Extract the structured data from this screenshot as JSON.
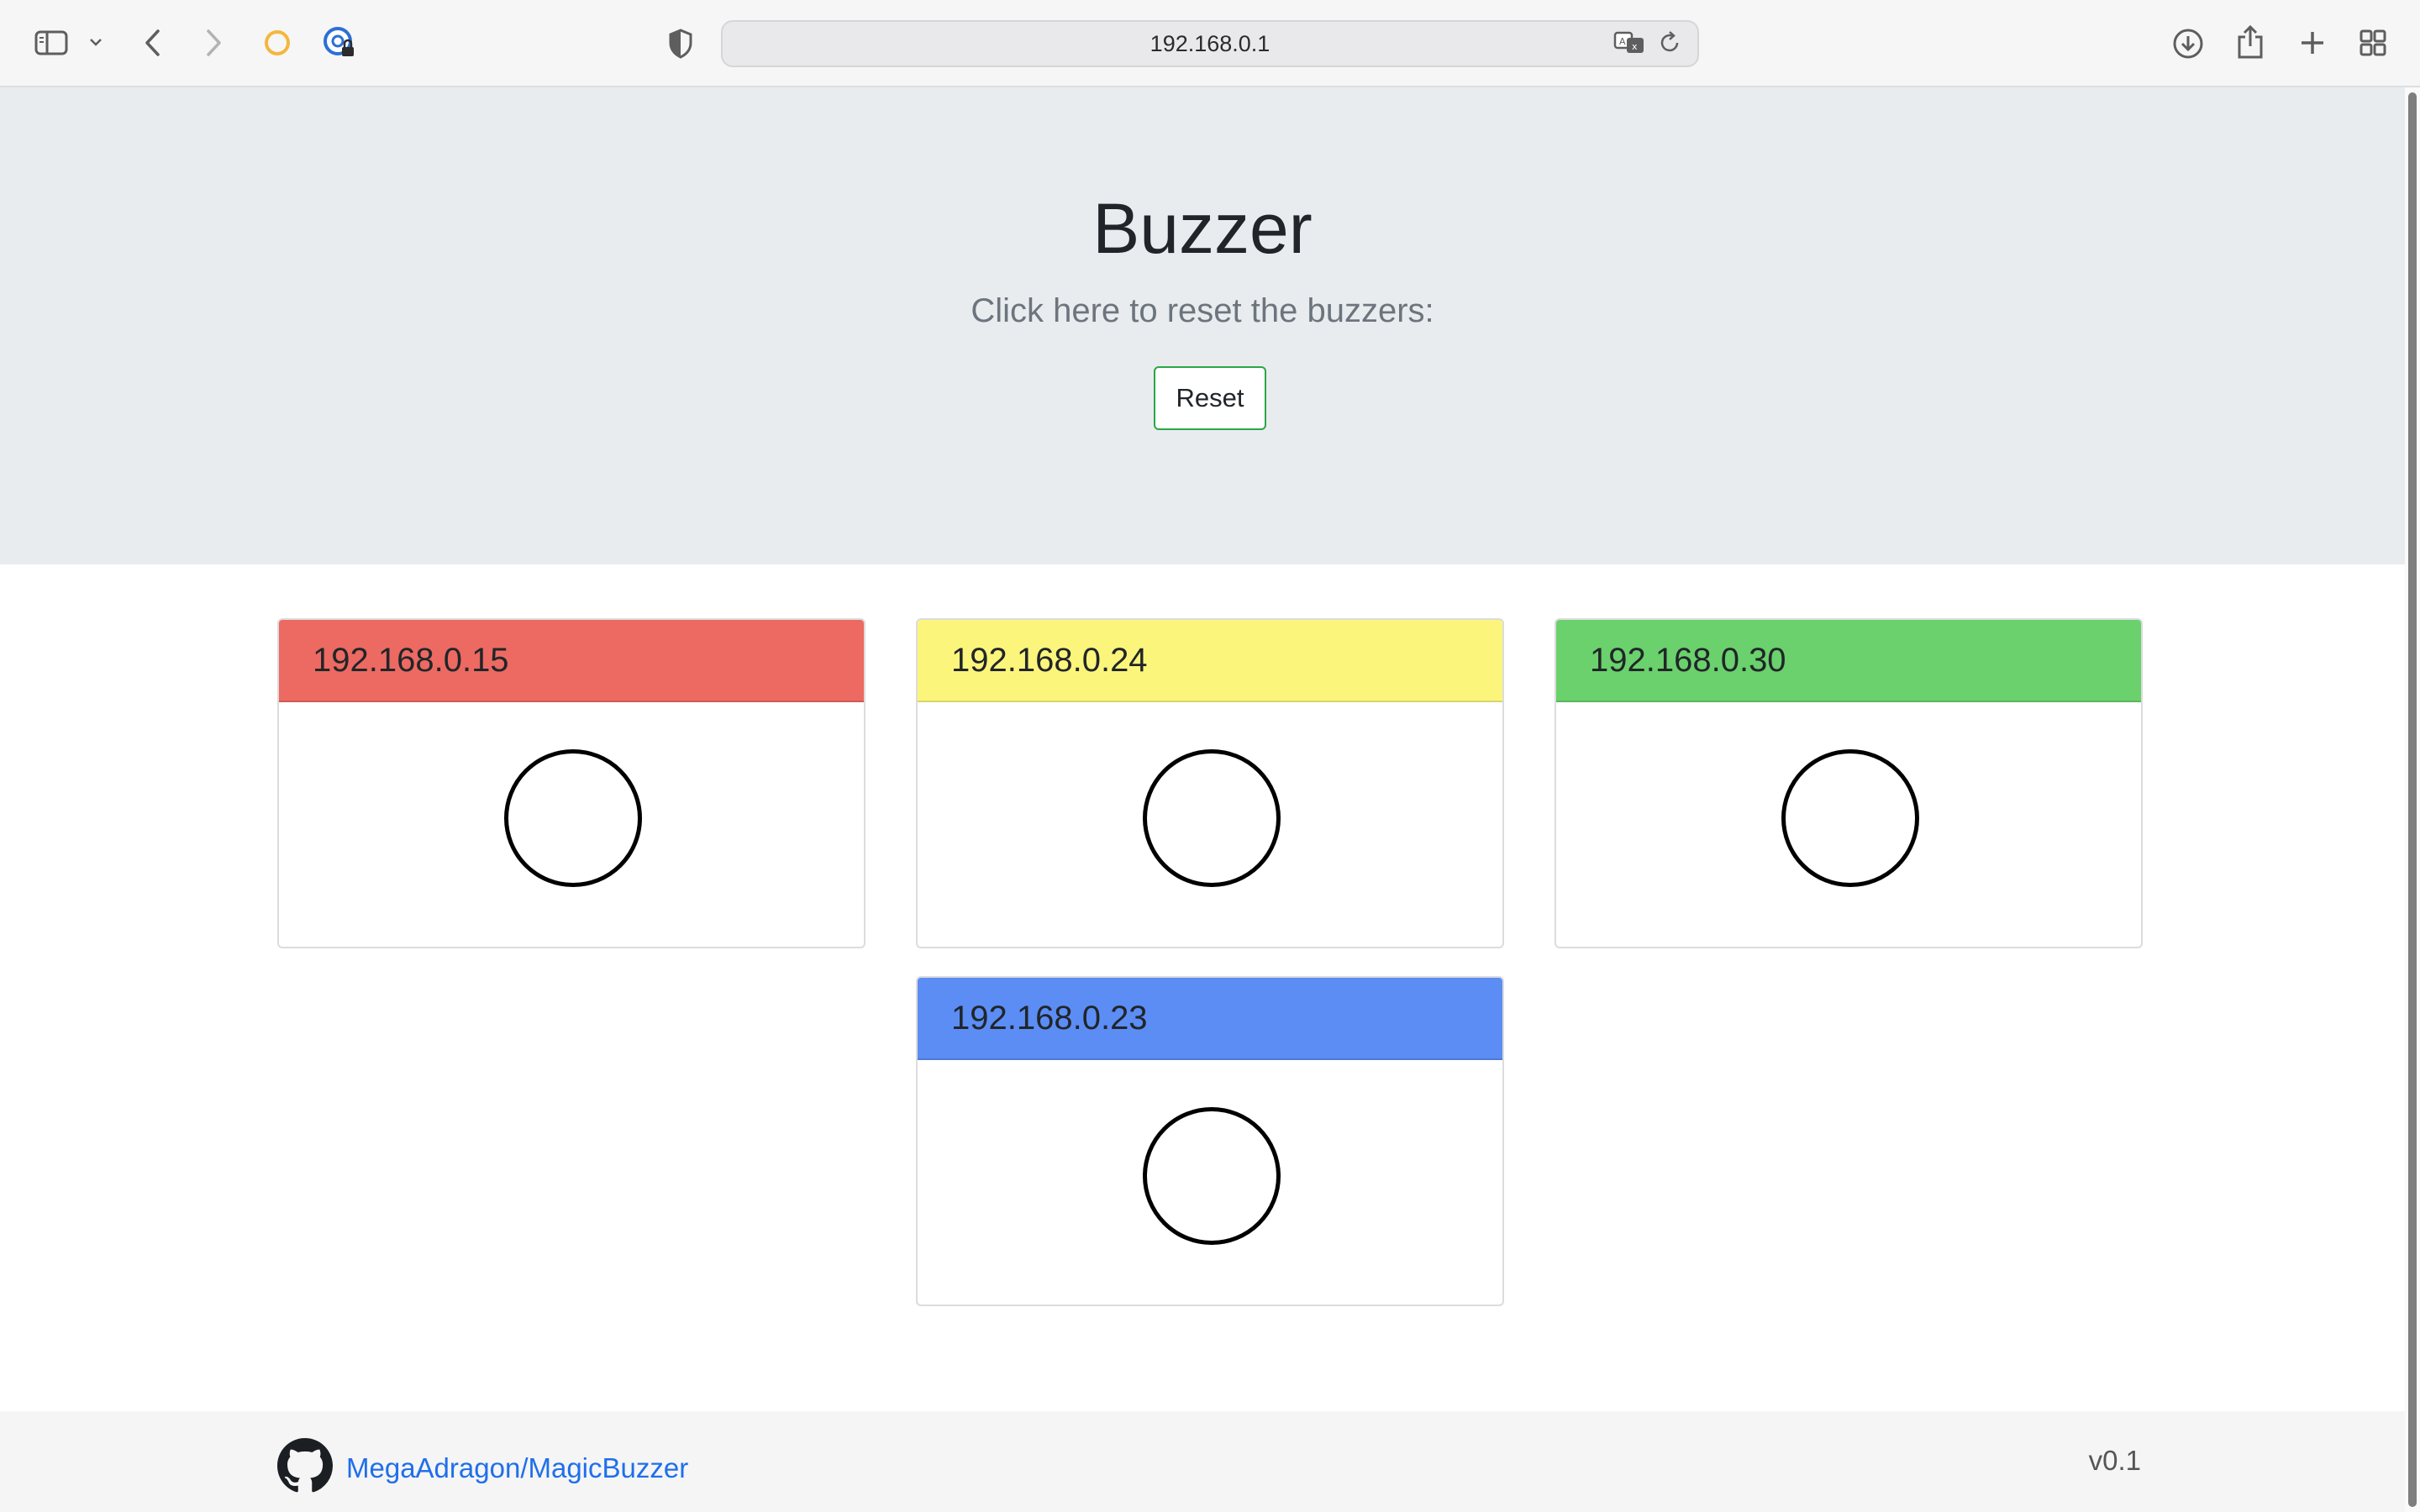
{
  "browser": {
    "url": "192.168.0.1",
    "icons": {
      "sidebar": "sidebar-icon",
      "sidebar_menu": "chevron-down-icon",
      "back": "back-arrow-icon",
      "forward": "forward-arrow-icon",
      "extension1": "circle-extension-icon",
      "extension2": "password-lock-icon",
      "privacy": "shield-icon",
      "translate": "translate-icon",
      "reload": "reload-icon",
      "downloads": "download-icon",
      "share": "share-icon",
      "new_tab": "plus-icon",
      "tab_overview": "tab-grid-icon"
    }
  },
  "hero": {
    "title": "Buzzer",
    "lead": "Click here to reset the buzzers:",
    "reset_label": "Reset"
  },
  "buzzers": [
    {
      "ip": "192.168.0.15",
      "color": "#ec6a62"
    },
    {
      "ip": "192.168.0.24",
      "color": "#fcf57c"
    },
    {
      "ip": "192.168.0.30",
      "color": "#6ad16c"
    },
    {
      "ip": "192.168.0.23",
      "color": "#5b8df5"
    }
  ],
  "footer": {
    "repo_link": "MegaAdragon/MagicBuzzer",
    "repo_icon": "github-icon",
    "version": "v0.1"
  }
}
